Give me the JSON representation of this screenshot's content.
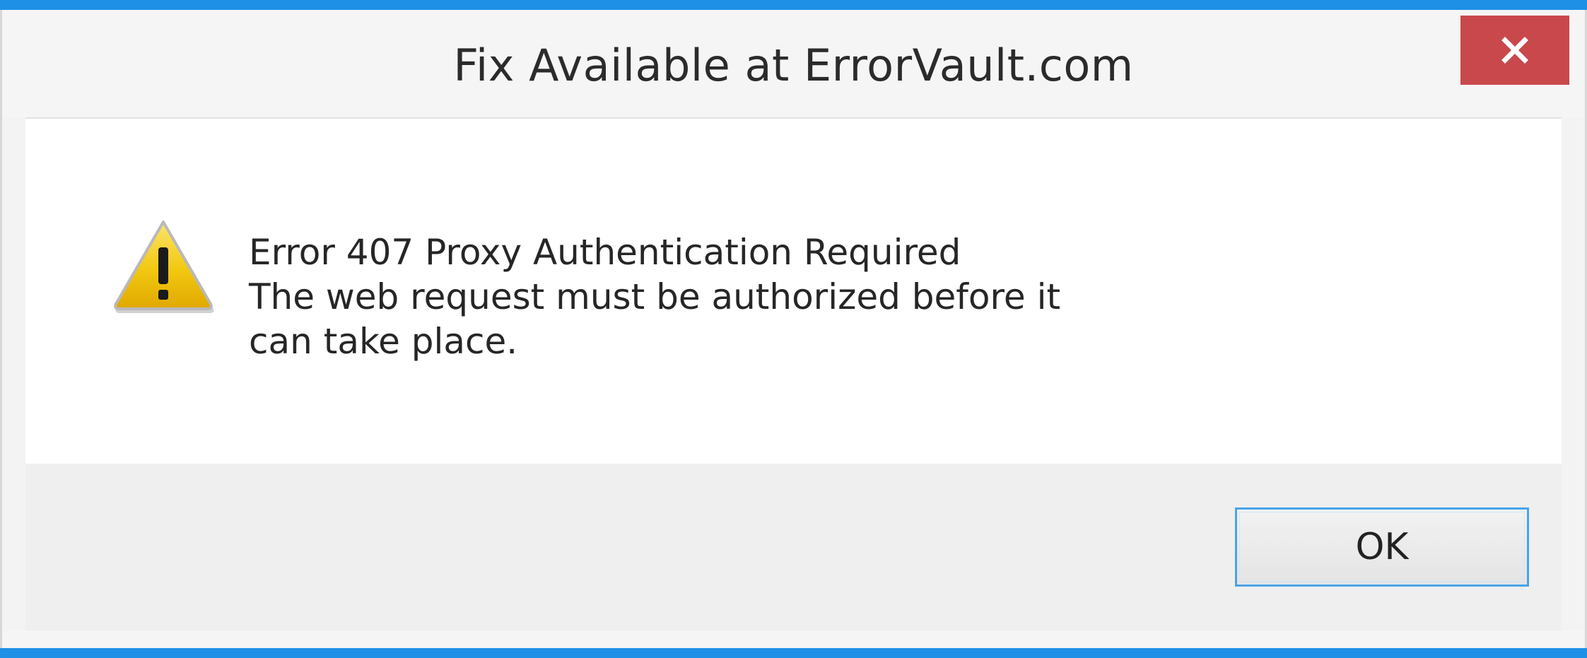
{
  "dialog": {
    "title": "Fix Available at ErrorVault.com",
    "close_glyph": "✕",
    "icon": "warning-icon",
    "message_lines": [
      "Error 407 Proxy Authentication Required",
      "The web request must be authorized before it",
      "can take place."
    ],
    "ok_label": "OK"
  },
  "colors": {
    "frame_accent": "#1e90e6",
    "close_button": "#c9484b",
    "ok_focus_border": "#4aa3e8",
    "warning_fill": "#f2c811"
  }
}
